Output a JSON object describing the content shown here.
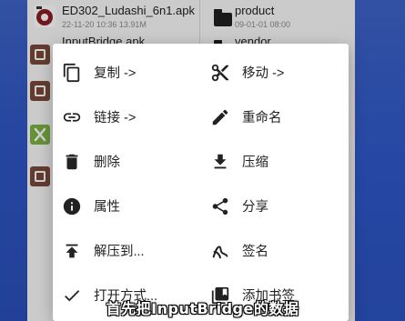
{
  "left_pane": {
    "file1": {
      "title": "ED302_Ludashi_6n1.apk",
      "meta": "22-11-20 10:36  13.91M",
      "icon": "ludashi-app-icon"
    },
    "file2_partial_title": "InputBridge.apk"
  },
  "right_pane": {
    "folder1": {
      "title": "product",
      "meta": "09-01-01 08:00",
      "icon": "folder-icon"
    },
    "folder2_partial_title": "vendor"
  },
  "menu": {
    "items": [
      {
        "label": "复制 ->",
        "icon": "copy-icon"
      },
      {
        "label": "移动 ->",
        "icon": "scissors-icon"
      },
      {
        "label": "链接 ->",
        "icon": "link-icon"
      },
      {
        "label": "重命名",
        "icon": "pencil-icon"
      },
      {
        "label": "删除",
        "icon": "trash-icon"
      },
      {
        "label": "压缩",
        "icon": "download-icon"
      },
      {
        "label": "属性",
        "icon": "info-icon"
      },
      {
        "label": "分享",
        "icon": "share-icon"
      },
      {
        "label": "解压到...",
        "icon": "upload-icon"
      },
      {
        "label": "签名",
        "icon": "signature-icon"
      },
      {
        "label": "打开方式...",
        "icon": "check-icon"
      },
      {
        "label": "添加书签",
        "icon": "bookmark-icon"
      }
    ]
  },
  "caption": "首先把InputBridge的数据",
  "colors": {
    "accent_blue": "#2f56c4",
    "apk_icon_red": "#8b1d24",
    "apk_box_brown": "#7a4a3a",
    "xposed_green": "#7cb342"
  }
}
